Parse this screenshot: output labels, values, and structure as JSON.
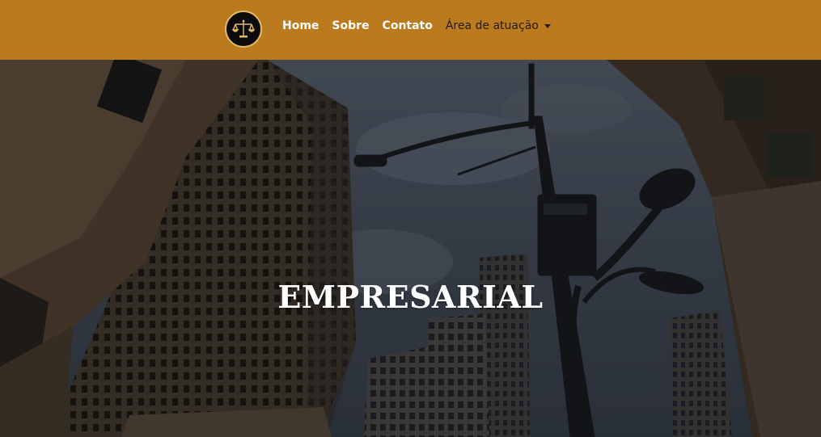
{
  "navbar": {
    "background": "#bc7a1f",
    "logo_icon": "scales-of-justice-icon",
    "links": [
      {
        "label": "Home"
      },
      {
        "label": "Sobre"
      },
      {
        "label": "Contato"
      },
      {
        "label": "Área de atuação",
        "has_dropdown": true
      }
    ]
  },
  "hero": {
    "background": "city-skyscrapers-streetlight-photo",
    "title": "EMPRESARIAL"
  }
}
